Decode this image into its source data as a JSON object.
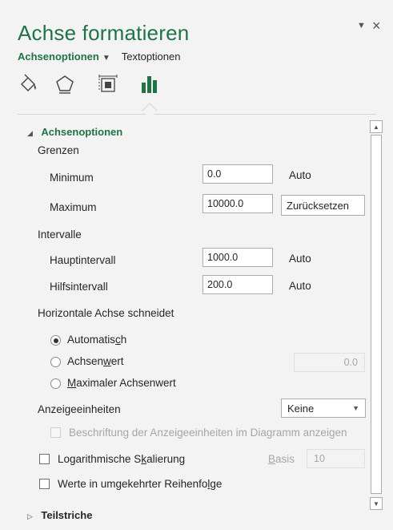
{
  "pane": {
    "title": "Achse formatieren",
    "pin_icon": "▼",
    "close_icon": "×"
  },
  "subtabs": {
    "active": "Achsenoptionen",
    "other": "Textoptionen"
  },
  "icons": [
    "fill-line-icon",
    "effects-icon",
    "size-properties-icon",
    "axis-options-icon"
  ],
  "section_axis": {
    "title": "Achsenoptionen",
    "grenzen": "Grenzen",
    "minimum_label": "Minimum",
    "minimum_value": "0.0",
    "minimum_state": "Auto",
    "maximum_label": "Maximum",
    "maximum_value": "10000.0",
    "reset_button": "Zurücksetzen",
    "intervalle": "Intervalle",
    "haupt_label": "Hauptintervall",
    "haupt_value": "1000.0",
    "haupt_state": "Auto",
    "hilfs_label": "Hilfsintervall",
    "hilfs_value": "200.0",
    "hilfs_state": "Auto",
    "cross_heading": "Horizontale Achse schneidet",
    "radio_auto_pre": "Automatis",
    "radio_auto_u": "c",
    "radio_auto_post": "h",
    "radio_wert_pre": "Achsen",
    "radio_wert_u": "w",
    "radio_wert_post": "ert",
    "radio_wert_value": "0.0",
    "radio_max_u": "M",
    "radio_max_post": "aximaler Achsenwert",
    "units_pre": "Anzei",
    "units_u": "g",
    "units_post": "eeinheiten",
    "units_value": "Keine",
    "show_units_pre": "Beschriftung der Anzeigeeinheiten im Dia",
    "show_units_u": "g",
    "show_units_post": "ramm anzeigen",
    "log_pre": "Logarithmische S",
    "log_u": "k",
    "log_post": "alierung",
    "basis_u": "B",
    "basis_post": "asis",
    "basis_value": "10",
    "reverse_pre": "Werte in umgekehrter Reihenfo",
    "reverse_u": "l",
    "reverse_post": "ge"
  },
  "section_ticks": {
    "title": "Teilstriche"
  },
  "colors": {
    "accent": "#217346",
    "pane_bg": "#f3f3f3"
  }
}
